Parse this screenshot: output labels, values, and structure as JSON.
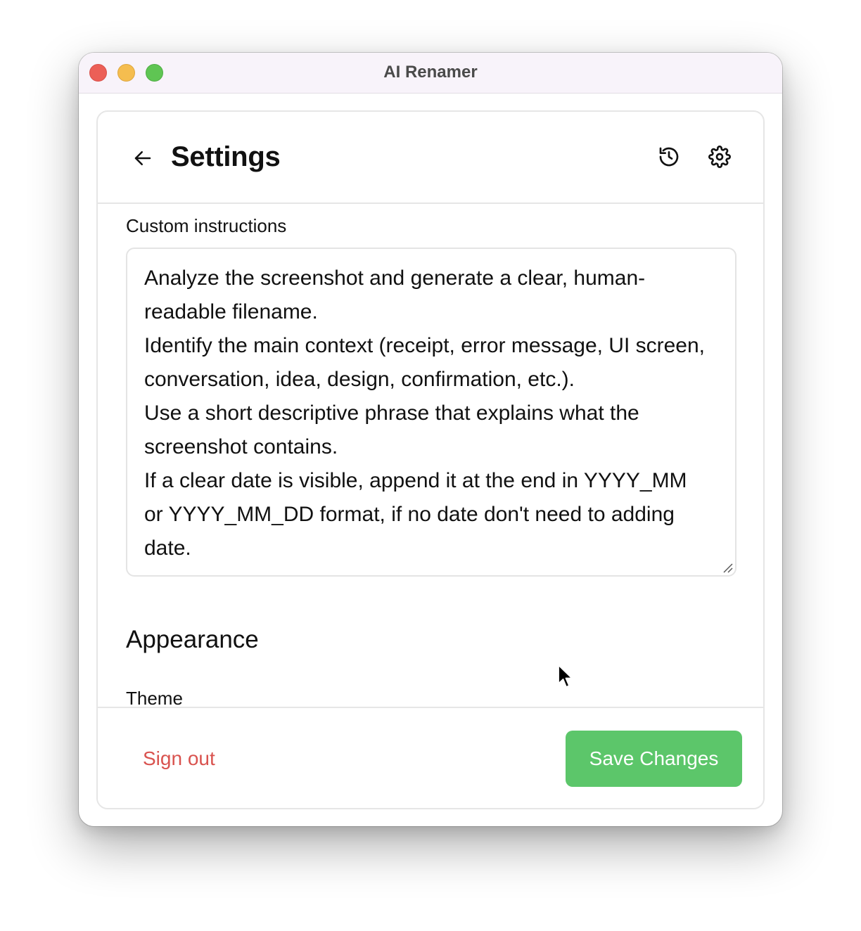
{
  "window": {
    "title": "AI Renamer"
  },
  "header": {
    "title": "Settings",
    "icons": {
      "back": "arrow-left-icon",
      "history": "history-icon",
      "settings": "gear-icon"
    }
  },
  "custom_instructions": {
    "label": "Custom instructions",
    "value": "Analyze the screenshot and generate a clear, human-readable filename.\nIdentify the main context (receipt, error message, UI screen, conversation, idea, design, confirmation, etc.).\nUse a short descriptive phrase that explains what the screenshot contains.\nIf a clear date is visible, append it at the end in YYYY_MM or YYYY_MM_DD format, if no date don't need to adding date."
  },
  "appearance": {
    "section_title": "Appearance",
    "theme_label": "Theme"
  },
  "footer": {
    "sign_out_label": "Sign out",
    "save_label": "Save Changes"
  },
  "colors": {
    "accent_green": "#5cc66a",
    "danger_red": "#d9534f",
    "traffic_close": "#ec5f57",
    "traffic_minimize": "#f5bd4f",
    "traffic_zoom": "#5fc553"
  }
}
